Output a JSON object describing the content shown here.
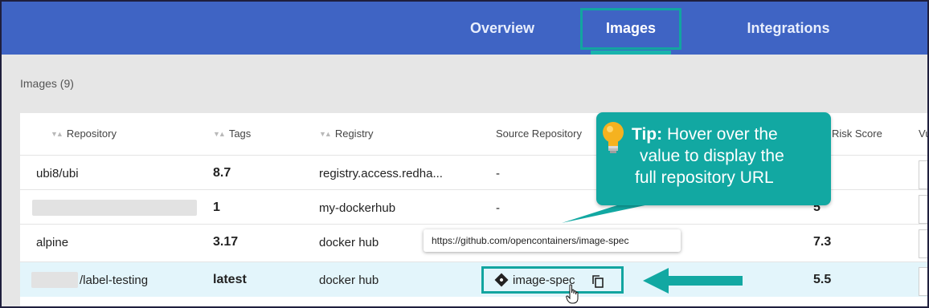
{
  "nav": {
    "tabs": [
      {
        "label": "Overview"
      },
      {
        "label": "Images"
      },
      {
        "label": "Integrations"
      }
    ],
    "active_tab": "Images"
  },
  "images_count": "Images (9)",
  "table": {
    "headers": [
      "Repository",
      "Tags",
      "Registry",
      "Source Repository",
      "Risk Score",
      "Vu"
    ],
    "rows": [
      {
        "repository": "ubi8/ubi",
        "tag": "8.7",
        "registry": "registry.access.redha...",
        "source": "-",
        "score": ""
      },
      {
        "repository": "",
        "tag": "1",
        "registry": "my-dockerhub",
        "source": "-",
        "score": "5"
      },
      {
        "repository": "alpine",
        "tag": "3.17",
        "registry": "docker hub",
        "source": "",
        "score": "7.3"
      },
      {
        "repository": "/label-testing",
        "tag": "latest",
        "registry": "docker hub",
        "source": "image-spec",
        "score": "5.5"
      }
    ]
  },
  "tooltip": {
    "url": "https://github.com/opencontainers/image-spec"
  },
  "callout": {
    "tip_label": "Tip:",
    "line1": "Hover over the",
    "line2": "value to display the",
    "line3": "full repository URL"
  },
  "colors": {
    "nav_bg": "#3f64c4",
    "accent_teal": "#12a5a0",
    "row_highlight": "#e3f5fb"
  },
  "icons": [
    "sort-icon",
    "git-icon",
    "copy-icon",
    "cursor-hand-icon",
    "lightbulb-icon",
    "arrow-left-icon"
  ]
}
